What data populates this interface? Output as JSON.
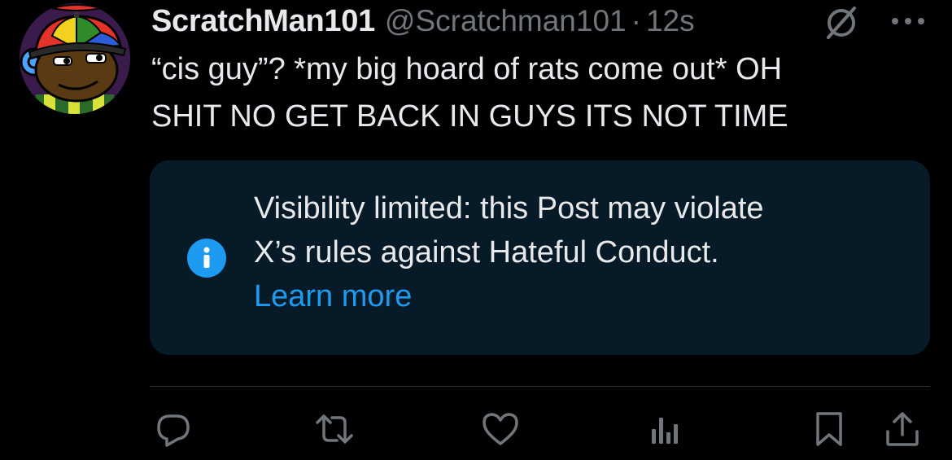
{
  "post": {
    "author": {
      "display_name": "ScratchMan101",
      "handle": "@Scratchman101",
      "separator": "·",
      "time": "12s"
    },
    "text_line1": "“cis guy”? *my big hoard of rats come out* OH",
    "text_line2": "SHIT NO GET BACK IN GUYS ITS NOT TIME"
  },
  "notice": {
    "line1": "Visibility limited: this Post may violate",
    "line2": "X’s rules against Hateful Conduct.",
    "learn_more": "Learn more",
    "icon": "info-icon"
  },
  "actions": {
    "reply_icon": "reply-icon",
    "repost_icon": "repost-icon",
    "like_icon": "like-icon",
    "views_icon": "views-icon",
    "bookmark_icon": "bookmark-icon",
    "share_icon": "share-icon"
  },
  "colors": {
    "background": "#000000",
    "text_primary": "#e7e9ea",
    "text_secondary": "#71767b",
    "accent": "#1d9bf0",
    "notice_background": "#071a27",
    "divider": "#2f3336"
  }
}
